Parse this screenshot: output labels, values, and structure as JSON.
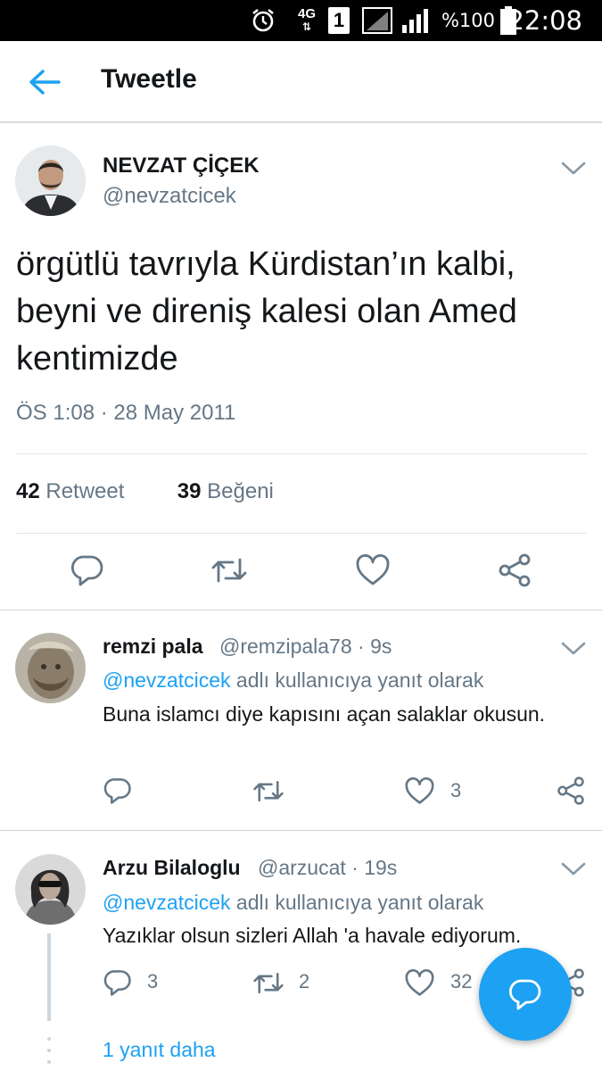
{
  "status_bar": {
    "network": "4G",
    "sim": "1",
    "battery": "%100",
    "time": "22:08"
  },
  "header": {
    "title": "Tweetle"
  },
  "tweet": {
    "name": "NEVZAT ÇİÇEK",
    "handle": "@nevzatcicek",
    "text": "örgütlü tavrıyla Kürdistan’ın kalbi, beyni ve direniş kalesi olan Amed kentimizde",
    "timestamp": "ÖS 1:08 · 28 May 2011",
    "retweets": "42",
    "retweets_label": "Retweet",
    "likes": "39",
    "likes_label": "Beğeni"
  },
  "replies": [
    {
      "name": "remzi pala",
      "handle": "@remzipala78",
      "time": "· 9s",
      "reply_mention": "@nevzatcicek",
      "reply_suffix": " adlı kullanıcıya yanıt olarak",
      "text": "Buna islamcı diye kapısını açan salaklar okusun.",
      "replies_count": "",
      "retweets_count": "",
      "likes_count": "3"
    },
    {
      "name": "Arzu Bilaloglu",
      "handle": "@arzucat",
      "time": "· 19s",
      "reply_mention": "@nevzatcicek",
      "reply_suffix": " adlı kullanıcıya yanıt olarak",
      "text": "Yazıklar olsun sizleri Allah 'a havale ediyorum.",
      "replies_count": "3",
      "retweets_count": "2",
      "likes_count": "32"
    }
  ],
  "more_replies": "1 yanıt daha",
  "colors": {
    "accent": "#1da1f2",
    "secondary_text": "#657786",
    "icon": "#657786"
  }
}
